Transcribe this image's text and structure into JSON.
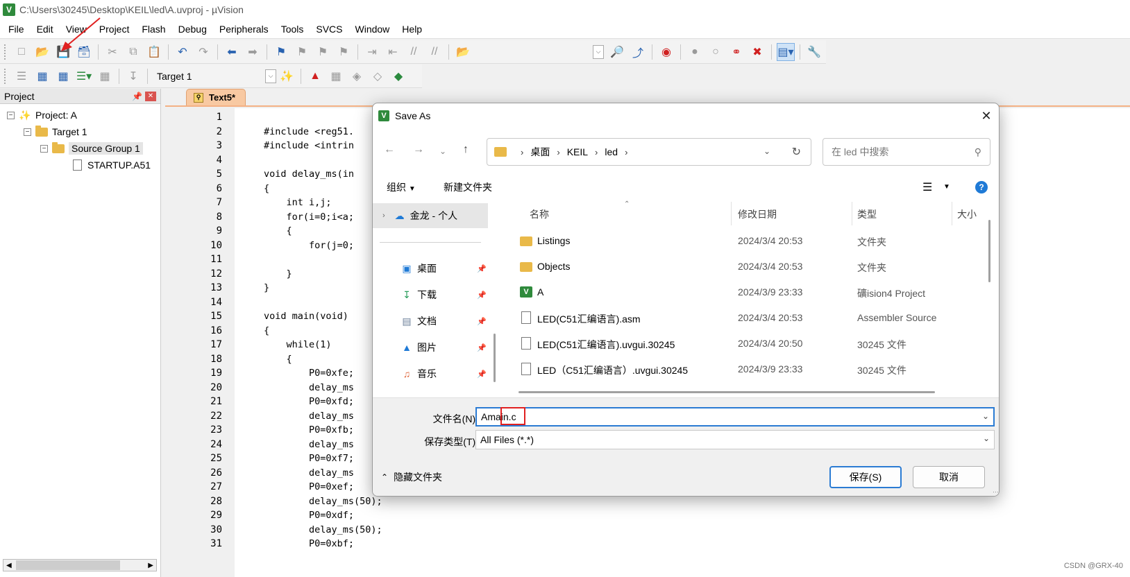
{
  "window": {
    "title": "C:\\Users\\30245\\Desktop\\KEIL\\led\\A.uvproj - µVision",
    "logo": "V"
  },
  "menubar": [
    "File",
    "Edit",
    "View",
    "Project",
    "Flash",
    "Debug",
    "Peripherals",
    "Tools",
    "SVCS",
    "Window",
    "Help"
  ],
  "toolbar2": {
    "target": "Target 1"
  },
  "project_panel": {
    "title": "Project",
    "tree": {
      "project": "Project: A",
      "target": "Target 1",
      "group": "Source Group 1",
      "file": "STARTUP.A51"
    }
  },
  "editor": {
    "tab": "Text5*",
    "line_numbers": [
      "1",
      "2",
      "3",
      "4",
      "5",
      "6",
      "7",
      "8",
      "9",
      "10",
      "11",
      "12",
      "13",
      "14",
      "15",
      "16",
      "17",
      "18",
      "19",
      "20",
      "21",
      "22",
      "23",
      "24",
      "25",
      "26",
      "27",
      "28",
      "29",
      "30",
      "31"
    ],
    "lines": [
      "",
      "#include <reg51.",
      "#include <intrin",
      "",
      "void delay_ms(in",
      "{",
      "    int i,j;",
      "    for(i=0;i<a;",
      "    {",
      "        for(j=0;",
      "",
      "    }",
      "}",
      "",
      "void main(void)",
      "{",
      "    while(1)",
      "    {",
      "        P0=0xfe;",
      "        delay_ms",
      "        P0=0xfd;",
      "        delay_ms",
      "        P0=0xfb;",
      "        delay_ms",
      "        P0=0xf7;",
      "        delay_ms",
      "        P0=0xef;",
      "        delay_ms(50);",
      "        P0=0xdf;",
      "        delay_ms(50);",
      "        P0=0xbf;"
    ]
  },
  "dialog": {
    "title": "Save As",
    "logo": "V",
    "breadcrumbs": [
      "桌面",
      "KEIL",
      "led"
    ],
    "search_placeholder": "在 led 中搜索",
    "organize": "组织",
    "new_folder": "新建文件夹",
    "help": "?",
    "nav": {
      "onedrive": "金龙 - 个人",
      "items": [
        "桌面",
        "下载",
        "文档",
        "图片",
        "音乐"
      ]
    },
    "columns": {
      "name": "名称",
      "date": "修改日期",
      "type": "类型",
      "size": "大小"
    },
    "files": [
      {
        "name": "Listings",
        "date": "2024/3/4 20:53",
        "type": "文件夹",
        "icon": "folder-icon"
      },
      {
        "name": "Objects",
        "date": "2024/3/4 20:53",
        "type": "文件夹",
        "icon": "folder-icon"
      },
      {
        "name": "A",
        "date": "2024/3/9 23:33",
        "type": "礦ision4 Project",
        "icon": "uvision-project-icon"
      },
      {
        "name": "LED(C51汇编语言).asm",
        "date": "2024/3/4 20:53",
        "type": "Assembler Source",
        "icon": "asm-file-icon"
      },
      {
        "name": "LED(C51汇编语言).uvgui.30245",
        "date": "2024/3/4 20:50",
        "type": "30245 文件",
        "icon": "file-icon"
      },
      {
        "name": "LED（C51汇编语言）.uvgui.30245",
        "date": "2024/3/9 23:33",
        "type": "30245 文件",
        "icon": "file-icon"
      }
    ],
    "filename_label": "文件名(N):",
    "filename_value": "Amain.c",
    "filetype_label": "保存类型(T):",
    "filetype_value": "All Files (*.*)",
    "hide_folders": "隐藏文件夹",
    "save": "保存(S)",
    "cancel": "取消"
  },
  "watermark": "CSDN @GRX-40",
  "colors": {
    "annotation": "#e02020",
    "accent": "#2a7bd3",
    "tab": "#f8c9a2"
  }
}
